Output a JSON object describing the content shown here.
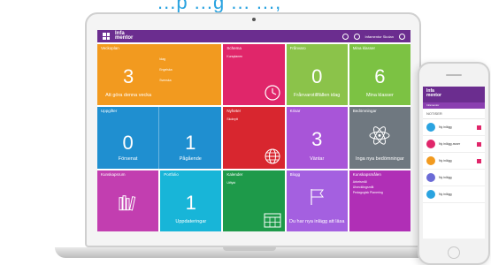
{
  "headline": "...p ...g ... ...,",
  "app": {
    "logo_line1": "Infa",
    "logo_line2": "mentor",
    "user_text": "Infamentor Skolan"
  },
  "tiles": [
    {
      "title": "Veckoplan",
      "num": "3",
      "sub": "Att göra denna vecka",
      "notes": [
        "Idag",
        "Engelska",
        "Svenska"
      ],
      "color": "#f29a1f"
    },
    {
      "title": "Schema",
      "note": "Kursplanen",
      "color": "#e0266a"
    },
    {
      "title": "Frånvaro",
      "num": "0",
      "sub": "Frånvarotillfällen idag",
      "color": "#8bc34a"
    },
    {
      "title": "Mina klasser",
      "num": "6",
      "sub": "Mina klasser",
      "color": "#7cc243"
    },
    {
      "title": "Uppgifter",
      "halves": [
        {
          "num": "0",
          "sub": "Försenat"
        },
        {
          "num": "1",
          "sub": "Pågående"
        }
      ],
      "color": "#1f8fd0"
    },
    {
      "title": "Nyheter",
      "note": "Skolnytt",
      "color": "#d8262f"
    },
    {
      "title": "Krisar",
      "num": "3",
      "sub": "Väntar",
      "color": "#a855d8"
    },
    {
      "title": "Bedömningar",
      "sub": "Inga nya bedömningar",
      "color": "#6f7880"
    },
    {
      "title": "Kunskapsrum",
      "color": "#c23eb0"
    },
    {
      "title": "Portfolio",
      "num": "1",
      "sub": "Uppdateringar",
      "color": "#18b5d8"
    },
    {
      "title": "Kalender",
      "note": "Utflykt",
      "color": "#1e9a4a"
    },
    {
      "title": "Blogg",
      "sub": "Du har nya inlägg att läsa",
      "color": "#a460e0"
    },
    {
      "title": "Kunskapsmålen",
      "list": [
        "Arbetsmål",
        "Utvecklingsmål",
        "Pedagogisk Planering"
      ],
      "color": "#b02fb6"
    }
  ],
  "phone": {
    "brand_line1": "Infa",
    "brand_line2": "mentor",
    "sub_title": "Infamentor",
    "head": "NOTISER",
    "items": [
      {
        "title": "Ny inlägg",
        "color": "#2aa3e0"
      },
      {
        "title": "Ny inlägg avser",
        "color": "#e0266a"
      },
      {
        "title": "Ny inlägg",
        "color": "#f29a1f"
      },
      {
        "title": "Ny inlägg",
        "color": "#6b6bd6"
      },
      {
        "title": "Ny inlägg",
        "color": "#2aa3e0"
      }
    ]
  }
}
